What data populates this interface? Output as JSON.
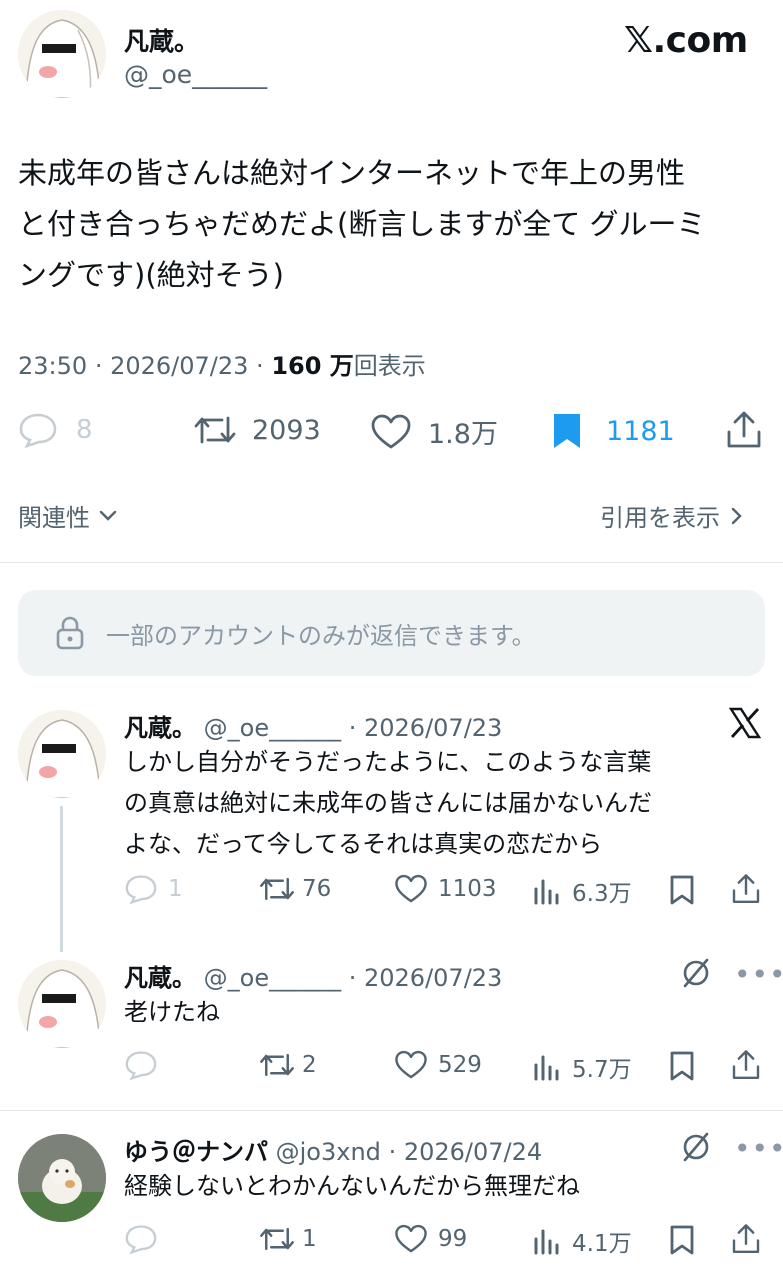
{
  "main_tweet": {
    "author_name": "凡蔵。",
    "author_handle": "@_oe______",
    "brand": "𝕏.com",
    "text_lines": [
      "未成年の皆さんは絶対インターネットで年上の男性",
      "と付き合っちゃだめだよ(断言しますが全て グルーミ",
      "ングです)(絶対そう)"
    ],
    "time": "23:50",
    "date": "2026/07/23",
    "views_count": "160 万",
    "views_label": "回表示",
    "stats": {
      "replies": "8",
      "retweets": "2093",
      "likes": "1.8万",
      "bookmarks": "1181"
    },
    "relevance_label": "関連性",
    "quotes_label": "引用を表示"
  },
  "restriction_notice": "一部のアカウントのみが返信できます。",
  "replies": [
    {
      "name": "凡蔵。",
      "handle": "@_oe______",
      "date": "· 2026/07/23",
      "text_lines": [
        "しかし自分がそうだったように、このような言葉",
        "の真意は絶対に未成年の皆さんには届かないんだ",
        "よな、だって今してるそれは真実の恋だから"
      ],
      "replies": "1",
      "retweets": "76",
      "likes": "1103",
      "views": "6.3万"
    },
    {
      "name": "凡蔵。",
      "handle": "@_oe______",
      "date": "· 2026/07/23",
      "text_lines": [
        "老けたね"
      ],
      "replies": "",
      "retweets": "2",
      "likes": "529",
      "views": "5.7万"
    },
    {
      "name": "ゆう＠ナンパ",
      "handle": "@jo3xnd",
      "date": "· 2026/07/24",
      "text_lines": [
        "経験しないとわかんないんだから無理だね"
      ],
      "replies": "",
      "retweets": "1",
      "likes": "99",
      "views": "4.1万"
    }
  ],
  "colors": {
    "text": "#0f1419",
    "muted": "#536471",
    "bookmark_active": "#1d9bf0",
    "notice_bg": "#eff3f4",
    "divider": "#e6e9ec"
  }
}
